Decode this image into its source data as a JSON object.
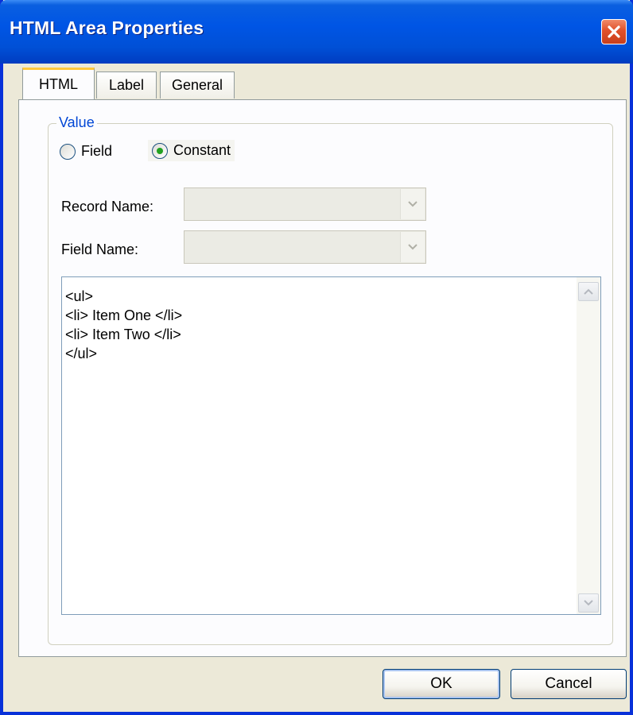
{
  "window": {
    "title": "HTML Area Properties",
    "close_symbol": "✕"
  },
  "tabs": [
    {
      "label": "HTML",
      "active": true
    },
    {
      "label": "Label",
      "active": false
    },
    {
      "label": "General",
      "active": false
    }
  ],
  "value_group": {
    "legend": "Value",
    "options": [
      {
        "label": "Field",
        "selected": false
      },
      {
        "label": "Constant",
        "selected": true
      }
    ]
  },
  "fields": {
    "record_name": {
      "label": "Record Name:",
      "value": ""
    },
    "field_name": {
      "label": "Field Name:",
      "value": ""
    }
  },
  "html_text": {
    "lines": [
      "<ul>",
      "<li> Item One </li>",
      "<li> Item Two </li>",
      "</ul>"
    ]
  },
  "buttons": {
    "ok_label": "OK",
    "cancel_label": "Cancel"
  },
  "colors": {
    "titlebar_blue": "#0055e5",
    "legend_blue": "#0046d5",
    "active_tab_accent": "#ffc83c",
    "radio_selected": "#21a121"
  },
  "icons": {
    "close": "close-icon",
    "dropdown": "chevron-down-icon",
    "scroll_up": "chevron-up-icon",
    "scroll_down": "chevron-down-icon"
  }
}
